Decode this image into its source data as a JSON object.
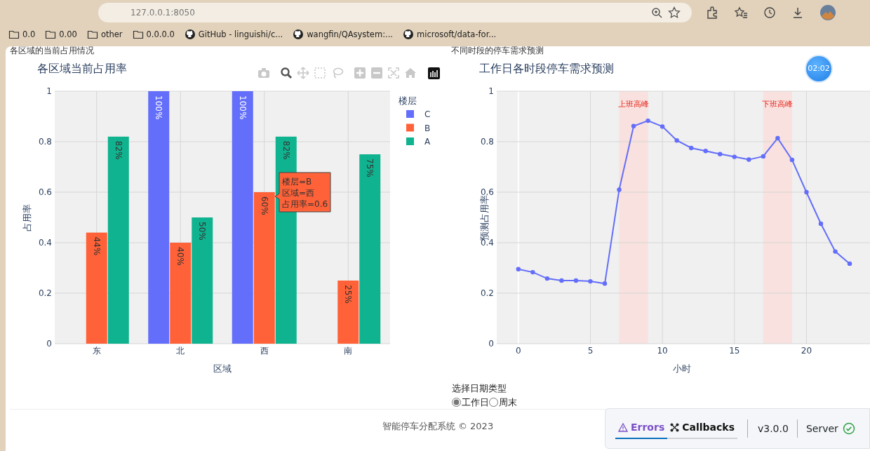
{
  "browser": {
    "url": "127.0.0.1:8050",
    "bookmarks": [
      {
        "kind": "folder",
        "label": "0.0"
      },
      {
        "kind": "folder",
        "label": "0.00"
      },
      {
        "kind": "folder",
        "label": "other"
      },
      {
        "kind": "folder",
        "label": "0.0.0.0"
      },
      {
        "kind": "github",
        "label": "GitHub - linguishi/c..."
      },
      {
        "kind": "github",
        "label": "wangfin/QAsystem:..."
      },
      {
        "kind": "github",
        "label": "microsoft/data-for..."
      }
    ]
  },
  "sections": [
    {
      "heading": "各区域的当前占用情况"
    },
    {
      "heading": "不同时段的停车需求预测"
    }
  ],
  "bar_chart": {
    "hover_label": [
      "楼层=B",
      "区域=西",
      "占用率=0.6"
    ],
    "chart_data": {
      "type": "bar",
      "title": "各区域当前占用率",
      "xlabel": "区域",
      "ylabel": "占用率",
      "categories": [
        "东",
        "北",
        "西",
        "南"
      ],
      "series": [
        {
          "name": "C",
          "color": "#636efa",
          "values": [
            null,
            1,
            1,
            null
          ],
          "value_labels": [
            null,
            "100%",
            "100%",
            null
          ]
        },
        {
          "name": "B",
          "color": "#ff6238",
          "values": [
            0.44,
            0.4,
            0.6,
            0.25
          ],
          "value_labels": [
            "44%",
            "40%",
            "60%",
            "25%"
          ]
        },
        {
          "name": "A",
          "color": "#10b38f",
          "values": [
            0.82,
            0.5,
            0.82,
            0.75
          ],
          "value_labels": [
            "82%",
            "50%",
            "82%",
            "75%"
          ]
        }
      ],
      "ylim": [
        0,
        1
      ],
      "yticks": [
        0,
        0.2,
        0.4,
        0.6,
        0.8,
        1
      ],
      "grid": true,
      "legend": {
        "title": "楼层"
      }
    }
  },
  "line_chart": {
    "chart_data": {
      "type": "line",
      "title": "工作日各时段停车需求预测",
      "xlabel": "小时",
      "ylabel": "预测占用率",
      "x": [
        0,
        1,
        2,
        3,
        4,
        5,
        6,
        7,
        8,
        9,
        10,
        11,
        12,
        13,
        14,
        15,
        16,
        17,
        18,
        19,
        20,
        21,
        22,
        23
      ],
      "series": [
        {
          "color": "#636efa",
          "marker": "circle",
          "values": [
            0.295,
            0.283,
            0.258,
            0.25,
            0.25,
            0.247,
            0.238,
            0.61,
            0.862,
            0.883,
            0.86,
            0.805,
            0.775,
            0.763,
            0.751,
            0.74,
            0.729,
            0.742,
            0.814,
            0.728,
            0.6,
            0.475,
            0.365,
            0.317
          ]
        }
      ],
      "xlim": [
        -1.5,
        24.8
      ],
      "ylim": [
        0,
        1
      ],
      "xticks": [
        0,
        5,
        10,
        15,
        20
      ],
      "yticks": [
        0,
        0.2,
        0.4,
        0.6,
        0.8,
        1
      ],
      "grid": true,
      "bands": [
        {
          "axis": "x",
          "from": 7,
          "to": 9,
          "color": "#f8e1de"
        },
        {
          "axis": "x",
          "from": 17,
          "to": 19,
          "color": "#f8e1de"
        }
      ],
      "annotations": [
        "上班高峰",
        "下班高峰"
      ]
    }
  },
  "timer": "02:02",
  "date_type": {
    "label": "选择日期类型",
    "options": [
      {
        "label": "工作日",
        "selected": true
      },
      {
        "label": "周末",
        "selected": false
      }
    ]
  },
  "footer": "智能停车分配系统 © 2023",
  "debug_menu": {
    "tabs": [
      {
        "label": "Errors",
        "selected": true
      },
      {
        "label": "Callbacks",
        "selected": false
      }
    ],
    "version": "v3.0.0",
    "server": "Server"
  }
}
